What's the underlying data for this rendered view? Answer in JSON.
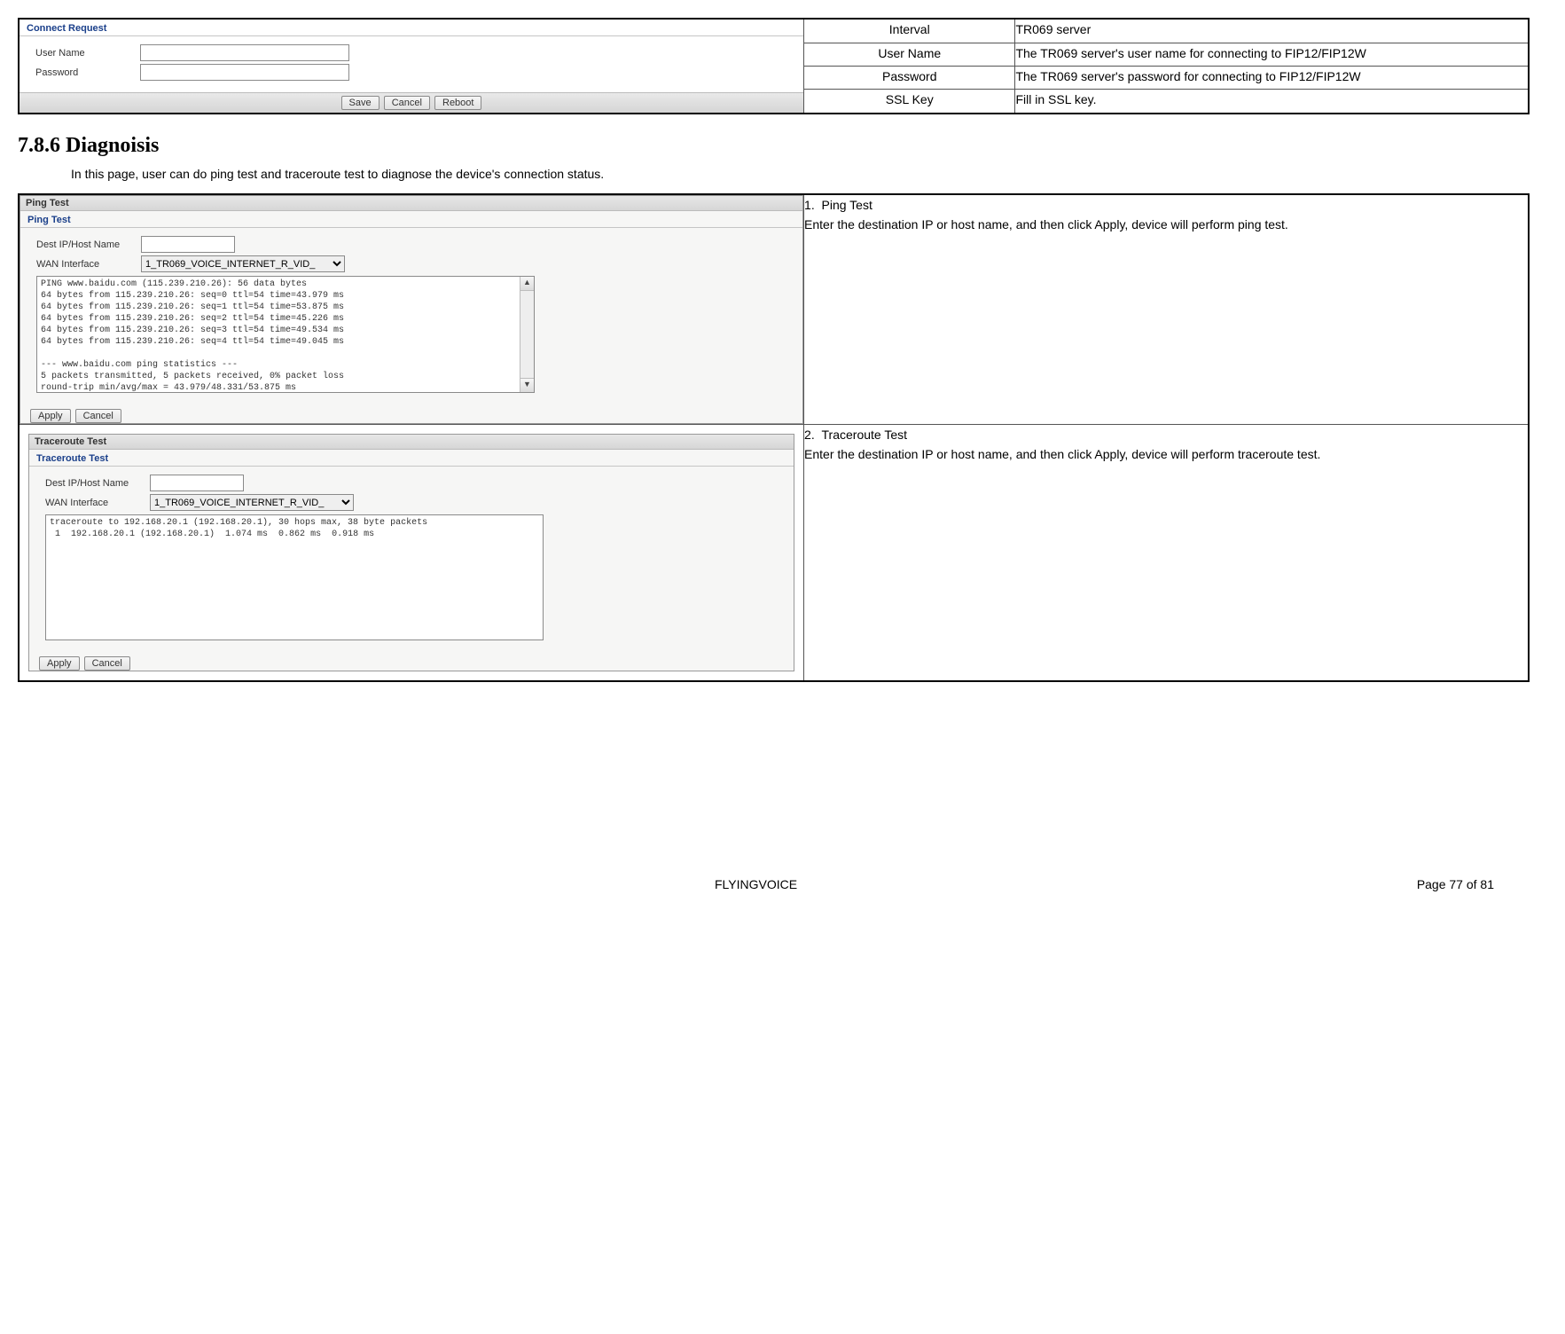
{
  "top_table": {
    "connect_request": {
      "title": "Connect Request",
      "username_label": "User Name",
      "password_label": "Password",
      "save_btn": "Save",
      "cancel_btn": "Cancel",
      "reboot_btn": "Reboot"
    },
    "rows": [
      {
        "field": "Interval",
        "desc": "TR069 server"
      },
      {
        "field": "User Name",
        "desc": "The TR069 server's user name for connecting to FIP12/FIP12W"
      },
      {
        "field": "Password",
        "desc": "The TR069 server's password for connecting to FIP12/FIP12W"
      },
      {
        "field": "SSL Key",
        "desc": "Fill in SSL key."
      }
    ]
  },
  "heading": "7.8.6  Diagnoisis",
  "intro": "In this page, user can do ping test and traceroute test to diagnose the device's connection status.",
  "diag_table": {
    "ping": {
      "panel_title": "Ping Test",
      "section_label": "Ping Test",
      "dest_label": "Dest IP/Host Name",
      "wan_label": "WAN Interface",
      "wan_value": "1_TR069_VOICE_INTERNET_R_VID_",
      "output": "PING www.baidu.com (115.239.210.26): 56 data bytes\n64 bytes from 115.239.210.26: seq=0 ttl=54 time=43.979 ms\n64 bytes from 115.239.210.26: seq=1 ttl=54 time=53.875 ms\n64 bytes from 115.239.210.26: seq=2 ttl=54 time=45.226 ms\n64 bytes from 115.239.210.26: seq=3 ttl=54 time=49.534 ms\n64 bytes from 115.239.210.26: seq=4 ttl=54 time=49.045 ms\n\n--- www.baidu.com ping statistics ---\n5 packets transmitted, 5 packets received, 0% packet loss\nround-trip min/avg/max = 43.979/48.331/53.875 ms",
      "apply_btn": "Apply",
      "cancel_btn": "Cancel",
      "desc_num": "1.",
      "desc_title": "Ping Test",
      "desc_body": "Enter the destination IP or host name, and then click Apply, device will perform ping test."
    },
    "traceroute": {
      "panel_title": "Traceroute Test",
      "section_label": "Traceroute Test",
      "dest_label": "Dest IP/Host Name",
      "wan_label": "WAN Interface",
      "wan_value": "1_TR069_VOICE_INTERNET_R_VID_",
      "output": "traceroute to 192.168.20.1 (192.168.20.1), 30 hops max, 38 byte packets\n 1  192.168.20.1 (192.168.20.1)  1.074 ms  0.862 ms  0.918 ms",
      "apply_btn": "Apply",
      "cancel_btn": "Cancel",
      "desc_num": "2.",
      "desc_title": "Traceroute Test",
      "desc_body": "Enter the destination IP or host name, and then click Apply, device will perform traceroute test."
    }
  },
  "footer": {
    "brand": "FLYINGVOICE",
    "page": "Page 77 of 81"
  }
}
